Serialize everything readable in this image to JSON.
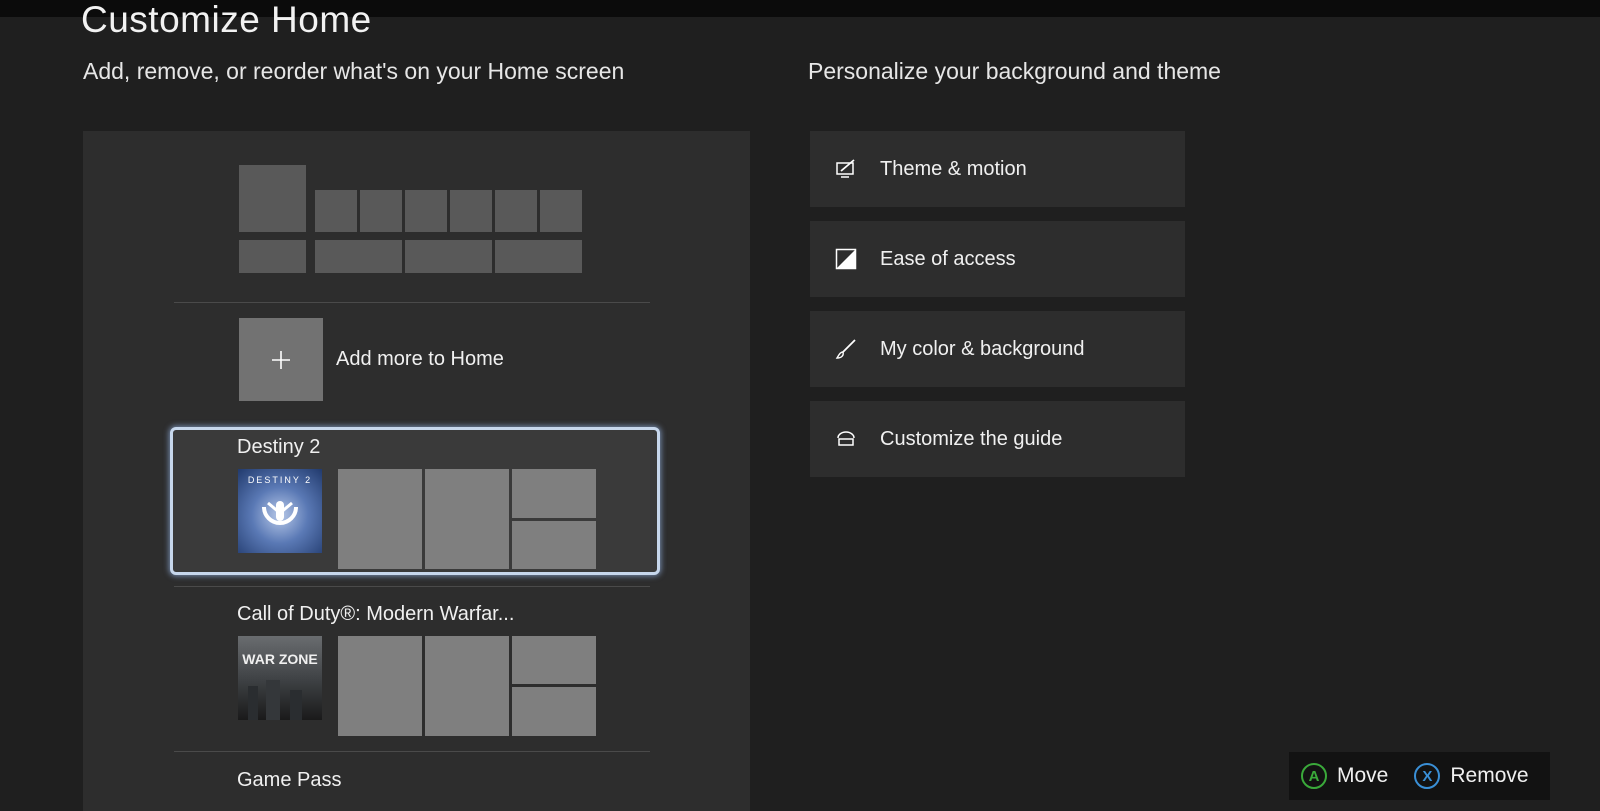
{
  "page": {
    "title": "Customize Home",
    "left_subtitle": "Add, remove, or reorder what's on your Home screen",
    "right_subtitle": "Personalize your background and theme"
  },
  "home_list": {
    "add_more_label": "Add more to Home",
    "add_icon": "plus-icon",
    "groups": [
      {
        "title": "Destiny 2",
        "art_text": "DESTINY 2",
        "art_icon": "destiny-emblem-icon",
        "selected": true
      },
      {
        "title": "Call of Duty®: Modern Warfar...",
        "art_text": "WAR ZONE",
        "art_icon": "warzone-art",
        "selected": false
      },
      {
        "title": "Game Pass",
        "selected": false
      }
    ]
  },
  "menu": {
    "items": [
      {
        "label": "Theme & motion",
        "icon": "theme-motion-icon"
      },
      {
        "label": "Ease of access",
        "icon": "ease-of-access-icon"
      },
      {
        "label": "My color & background",
        "icon": "brush-icon"
      },
      {
        "label": "Customize the guide",
        "icon": "guide-icon"
      }
    ]
  },
  "hints": {
    "move": {
      "button": "A",
      "label": "Move",
      "color": "#3aa93a"
    },
    "remove": {
      "button": "X",
      "label": "Remove",
      "color": "#3a8fd6"
    }
  },
  "colors": {
    "background": "#1f1f1f",
    "panel": "#2d2d2d",
    "selection_border": "#c7d7ec"
  }
}
